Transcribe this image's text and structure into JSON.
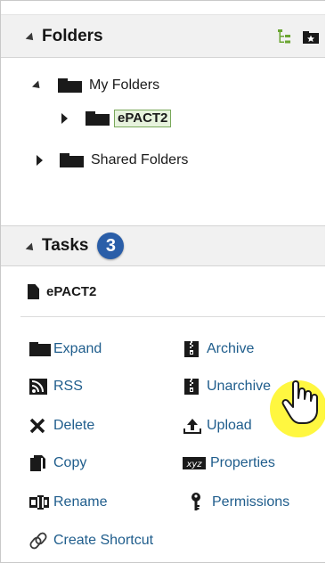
{
  "folders_pane": {
    "title": "Folders",
    "tools": {
      "tree_icon": "tree-view-icon",
      "new_folder_icon": "folder-star-icon"
    },
    "tree": {
      "my_folders": "My Folders",
      "selected_folder": "ePACT2",
      "shared_folders": "Shared Folders"
    }
  },
  "tasks_pane": {
    "title": "Tasks",
    "step_badge": "3",
    "selected_item": "ePACT2",
    "actions_left": [
      {
        "label": "Expand",
        "icon": "folder-icon"
      },
      {
        "label": "RSS",
        "icon": "rss-icon"
      },
      {
        "label": "Delete",
        "icon": "x-icon"
      },
      {
        "label": "Copy",
        "icon": "copy-icon"
      },
      {
        "label": "Rename",
        "icon": "rename-icon"
      },
      {
        "label": "Create Shortcut",
        "icon": "link-icon"
      }
    ],
    "actions_right": [
      {
        "label": "Archive",
        "icon": "archive-icon"
      },
      {
        "label": "Unarchive",
        "icon": "unarchive-icon"
      },
      {
        "label": "Upload",
        "icon": "upload-icon"
      },
      {
        "label": "Properties",
        "icon": "xyz-icon"
      },
      {
        "label": "Permissions",
        "icon": "key-icon"
      }
    ]
  },
  "colors": {
    "link": "#1f5d8c",
    "badge": "#2a5ea8",
    "selection_fill": "#e7f3dd",
    "selection_border": "#79a85a",
    "cursor_highlight": "#fff61e"
  }
}
